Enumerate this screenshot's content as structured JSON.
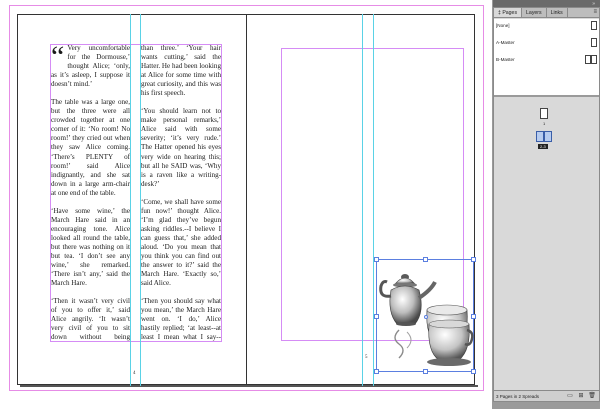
{
  "panel": {
    "tabs": [
      {
        "label": "‡ Pages",
        "active": true
      },
      {
        "label": "Layers",
        "active": false
      },
      {
        "label": "Links",
        "active": false
      }
    ],
    "menu_icon": "panel-menu-icon",
    "masters": [
      {
        "label": "[None]"
      },
      {
        "label": "A-Master"
      },
      {
        "label": "B-Master"
      }
    ],
    "spreads": [
      {
        "label": "1"
      },
      {
        "label": "2-3"
      }
    ],
    "footer_text": "3 Pages in 2 Spreads"
  },
  "document": {
    "left_col1": [
      "Very uncomfortable for the Dormouse,’ thought Alice; ‘only, as it’s asleep, I suppose it doesn’t mind.’",
      "The table was a large one, but the three were all crowded together at one corner of it: ‘No room! No room!’ they cried out when they saw Alice coming. ‘There’s PLENTY of room!’ said Alice indignantly, and she sat down in a large arm-chair at one end of the table.",
      "‘Have some wine,’ the March Hare said in an encouraging tone. Alice looked all round the table, but there was nothing on it but tea. ‘I don’t see any wine,’ she remarked. ‘There isn’t any,’ said the March Hare.",
      "‘Then it wasn’t very civil of you to offer it,’ said Alice angrily. ‘It wasn’t very civil of you to sit down without being invited,’ said the March Hare. ‘I didn’t know it was YOUR table,’ said Alice, ‘it’s laid for a great many more"
    ],
    "dropcap": "“",
    "left_col2": [
      "than three.’ ‘Your hair wants cutting,’ said the Hatter. He had been looking at Alice for some time with great curiosity, and this was his first speech.",
      "‘You should learn not to make personal remarks,’ Alice said with some severity; ‘it’s very rude.’ The Hatter opened his eyes very wide on hearing this; but all he SAID was, ‘Why is a raven like a writing-desk?’",
      "‘Come, we shall have some fun now!’ thought Alice. ‘I’m glad they’ve begun asking riddles.--I believe I can guess that,’ she added aloud. ‘Do you mean that you think you can find out the answer to it?’ said the March Hare. ‘Exactly so,’ said Alice.",
      "‘Then you should say what you mean,’ the March Hare went on. ‘I do,’ Alice hastily replied; ‘at least--at least I mean what I say--that’s the same thing, you know.’ ‘Not the same thing a bit!’ said the"
    ],
    "page_numbers": {
      "left": "4",
      "right": "5"
    },
    "image_name": "teapot-and-cups-image"
  }
}
